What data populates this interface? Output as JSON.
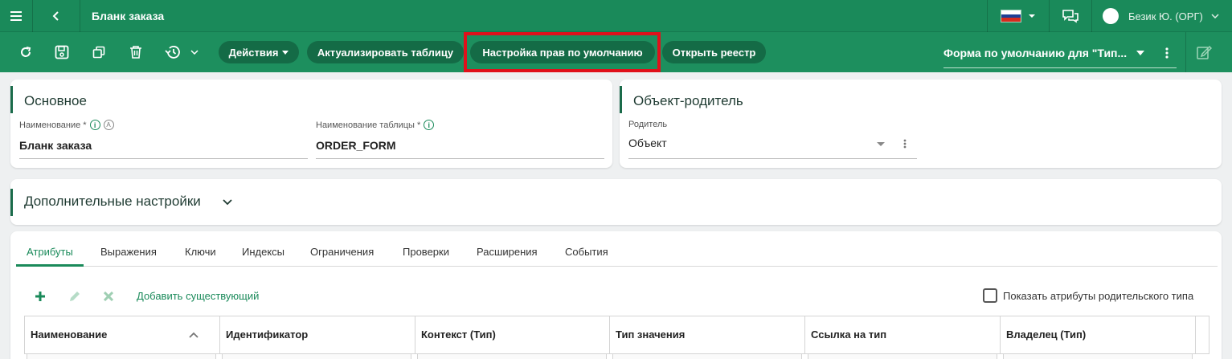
{
  "header": {
    "title": "Бланк заказа",
    "menu_icon": "hamburger-icon",
    "back_icon": "chevron-left-icon",
    "user_name": "Безик Ю. (ОРГ)",
    "language_flag_colors": [
      "#ffffff",
      "#1c3f95",
      "#d52b1e"
    ]
  },
  "toolbar": {
    "actions_label": "Действия",
    "refresh_table_label": "Актуализировать таблицу",
    "default_rights_label": "Настройка прав по умолчанию",
    "open_registry_label": "Открыть реестр",
    "form_select_value": "Форма по умолчанию для \"Тип..."
  },
  "main_card": {
    "title": "Основное",
    "name_label": "Наименование *",
    "name_value": "Бланк заказа",
    "table_name_label": "Наименование таблицы *",
    "table_name_value": "ORDER_FORM"
  },
  "parent_card": {
    "title": "Объект-родитель",
    "parent_label": "Родитель",
    "parent_value": "Объект"
  },
  "extra_card": {
    "title": "Дополнительные настройки"
  },
  "tabs": [
    {
      "label": "Атрибуты",
      "active": true
    },
    {
      "label": "Выражения",
      "active": false
    },
    {
      "label": "Ключи",
      "active": false
    },
    {
      "label": "Индексы",
      "active": false
    },
    {
      "label": "Ограничения",
      "active": false
    },
    {
      "label": "Проверки",
      "active": false
    },
    {
      "label": "Расширения",
      "active": false
    },
    {
      "label": "События",
      "active": false
    }
  ],
  "attributes": {
    "add_existing_label": "Добавить существующий",
    "show_parent_label": "Показать атрибуты родительского типа",
    "columns": [
      "Наименование",
      "Идентификатор",
      "Контекст (Тип)",
      "Тип значения",
      "Ссылка на тип",
      "Владелец (Тип)"
    ]
  },
  "colors": {
    "topbar": "#1a8a5a",
    "toolbar": "#1d8f5e",
    "pill": "#146b46",
    "highlight": "#e0111b"
  }
}
